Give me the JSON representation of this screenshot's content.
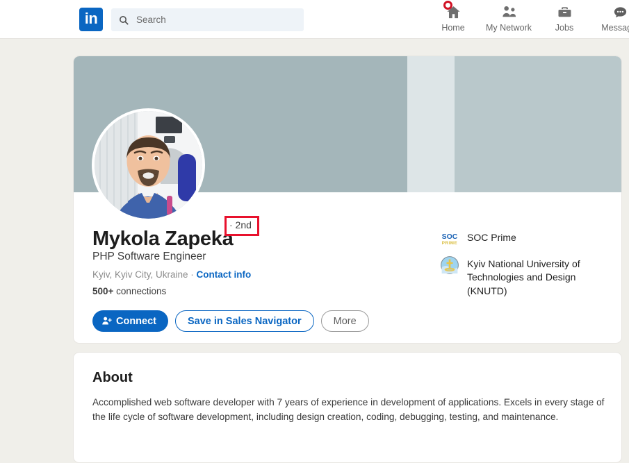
{
  "header": {
    "logo_text": "in",
    "logo_name": "linkedin-logo",
    "search": {
      "placeholder": "Search",
      "value": "",
      "icon": "search-icon"
    },
    "nav": [
      {
        "label": "Home",
        "icon": "home-icon",
        "badge": true
      },
      {
        "label": "My Network",
        "icon": "network-icon",
        "badge": false
      },
      {
        "label": "Jobs",
        "icon": "jobs-briefcase-icon",
        "badge": false
      },
      {
        "label": "Messagin",
        "icon": "messaging-icon",
        "badge": false
      }
    ]
  },
  "profile": {
    "name": "Mykola Zapeka",
    "degree": "· 2nd",
    "headline": "PHP Software Engineer",
    "location": "Kyiv, Kyiv City, Ukraine · ",
    "contact_link": "Contact info",
    "connections_count": "500+",
    "connections_label": " connections",
    "buttons": {
      "connect": "Connect",
      "save_sales_navigator": "Save in Sales Navigator",
      "more": "More"
    },
    "organizations": [
      {
        "name": "SOC Prime",
        "logo": "soc-prime-logo"
      },
      {
        "name": "Kyiv National University of Technologies and Design (KNUTD)",
        "logo": "knutd-crest-logo"
      }
    ]
  },
  "about": {
    "title": "About",
    "text": "Accomplished web software developer with 7 years of experience in development of applications. Excels in every stage of the life cycle of software development, including design creation, coding, debugging, testing, and maintenance."
  },
  "colors": {
    "linkedin_blue": "#0a66c2",
    "page_background": "#f0efea",
    "highlight_red": "#e8112d",
    "badge_red": "#d11124",
    "banner_primary": "#a4b6ba",
    "banner_secondary": "#b9c8cb"
  }
}
